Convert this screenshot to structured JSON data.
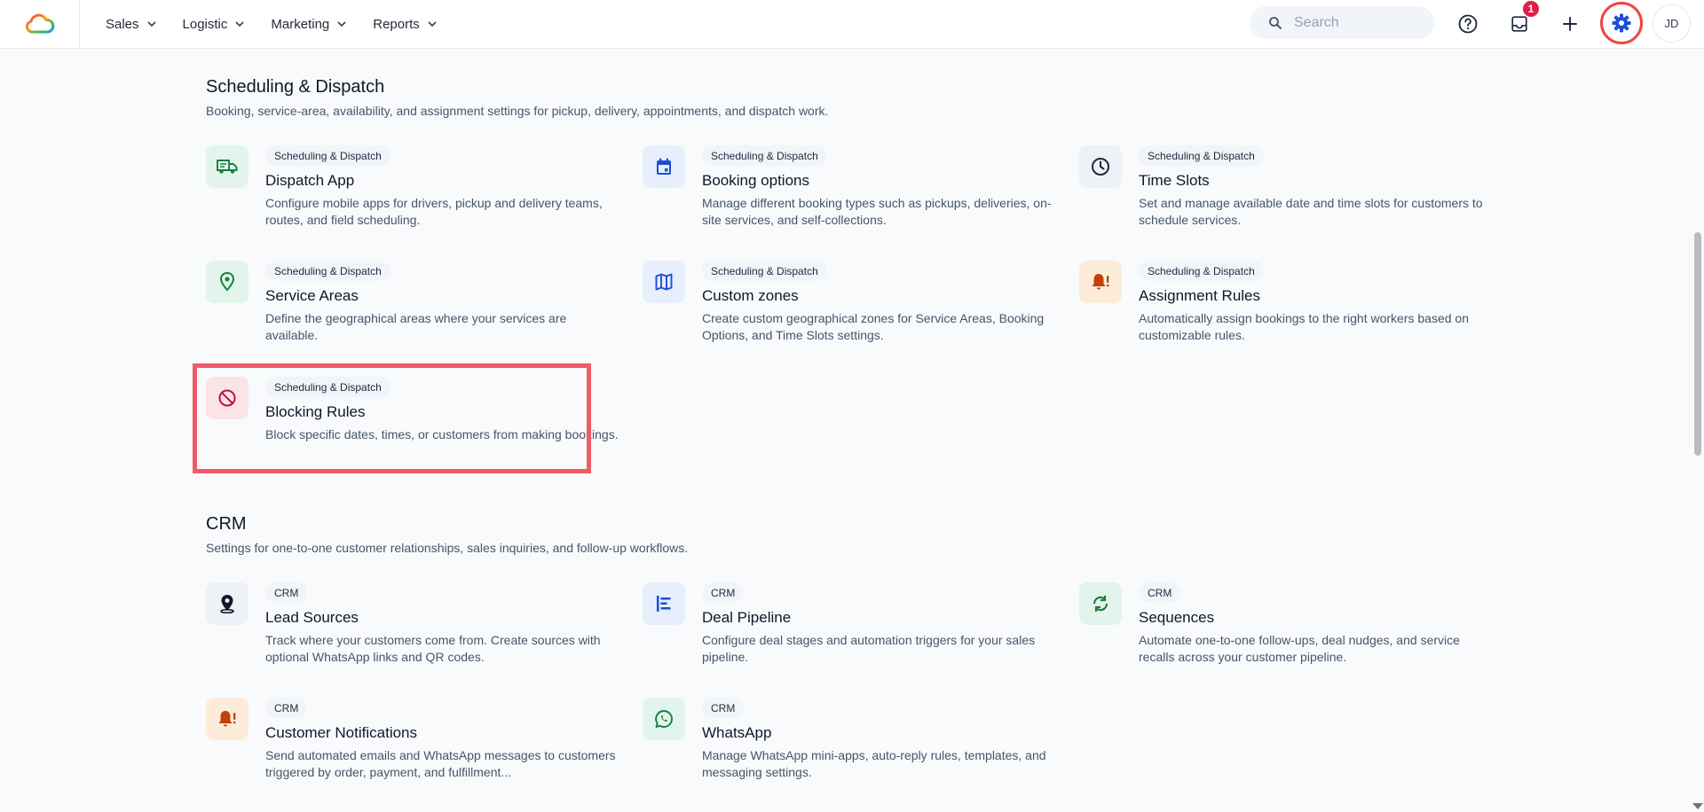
{
  "header": {
    "nav": [
      {
        "label": "Sales"
      },
      {
        "label": "Logistic"
      },
      {
        "label": "Marketing"
      },
      {
        "label": "Reports"
      }
    ],
    "search_placeholder": "Search",
    "inbox_badge": "1",
    "avatar_initials": "JD"
  },
  "sections": [
    {
      "title": "Scheduling & Dispatch",
      "subtitle": "Booking, service-area, availability, and assignment settings for pickup, delivery, appointments, and dispatch work.",
      "cards": [
        {
          "tag": "Scheduling & Dispatch",
          "title": "Dispatch App",
          "description": "Configure mobile apps for drivers, pickup and delivery teams, routes, and field scheduling.",
          "icon": "truck-icon",
          "icon_color": "#15803d",
          "icon_bg": "#e3f4ec"
        },
        {
          "tag": "Scheduling & Dispatch",
          "title": "Booking options",
          "description": "Manage different booking types such as pickups, deliveries, on-site services, and self-collections.",
          "icon": "calendar-icon",
          "icon_color": "#1d4ed8",
          "icon_bg": "#e6effb"
        },
        {
          "tag": "Scheduling & Dispatch",
          "title": "Time Slots",
          "description": "Set and manage available date and time slots for customers to schedule services.",
          "icon": "clock-icon",
          "icon_color": "#1e293b",
          "icon_bg": "#eef1f5"
        },
        {
          "tag": "Scheduling & Dispatch",
          "title": "Service Areas",
          "description": "Define the geographical areas where your services are available.",
          "icon": "map-pin-icon",
          "icon_color": "#15803d",
          "icon_bg": "#e3f4ec"
        },
        {
          "tag": "Scheduling & Dispatch",
          "title": "Custom zones",
          "description": "Create custom geographical zones for Service Areas, Booking Options, and Time Slots settings.",
          "icon": "map-icon",
          "icon_color": "#1d4ed8",
          "icon_bg": "#e6effb"
        },
        {
          "tag": "Scheduling & Dispatch",
          "title": "Assignment Rules",
          "description": "Automatically assign bookings to the right workers based on customizable rules.",
          "icon": "bell-alert-icon",
          "icon_color": "#c2410c",
          "icon_bg": "#fdecd9"
        },
        {
          "tag": "Scheduling & Dispatch",
          "title": "Blocking Rules",
          "description": "Block specific dates, times, or customers from making bookings.",
          "icon": "block-icon",
          "icon_color": "#be123c",
          "icon_bg": "#fbe4e6"
        }
      ]
    },
    {
      "title": "CRM",
      "subtitle": "Settings for one-to-one customer relationships, sales inquiries, and follow-up workflows.",
      "cards": [
        {
          "tag": "CRM",
          "title": "Lead Sources",
          "description": "Track where your customers come from. Create sources with optional WhatsApp links and QR codes.",
          "icon": "location-icon",
          "icon_color": "#0f172a",
          "icon_bg": "#eef1f5"
        },
        {
          "tag": "CRM",
          "title": "Deal Pipeline",
          "description": "Configure deal stages and automation triggers for your sales pipeline.",
          "icon": "pipeline-icon",
          "icon_color": "#1d4ed8",
          "icon_bg": "#e6effb"
        },
        {
          "tag": "CRM",
          "title": "Sequences",
          "description": "Automate one-to-one follow-ups, deal nudges, and service recalls across your customer pipeline.",
          "icon": "refresh-icon",
          "icon_color": "#15803d",
          "icon_bg": "#e3f4ec"
        },
        {
          "tag": "CRM",
          "title": "Customer Notifications",
          "description": "Send automated emails and WhatsApp messages to customers triggered by order, payment, and fulfillment...",
          "icon": "bell-alert-icon",
          "icon_color": "#c2410c",
          "icon_bg": "#fdecd9"
        },
        {
          "tag": "CRM",
          "title": "WhatsApp",
          "description": "Manage WhatsApp mini-apps, auto-reply rules, templates, and messaging settings.",
          "icon": "whatsapp-icon",
          "icon_color": "#15803d",
          "icon_bg": "#e3f4ec"
        }
      ]
    }
  ]
}
